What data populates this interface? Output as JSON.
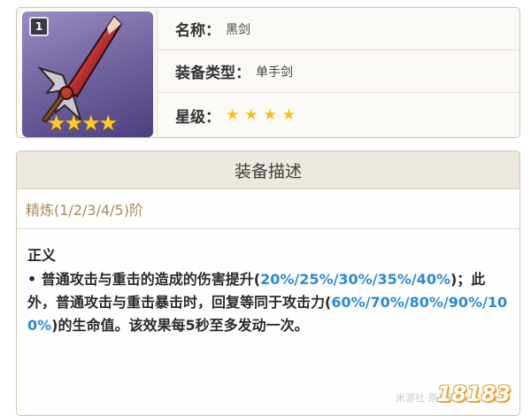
{
  "item": {
    "refinement_badge": "1",
    "name_label": "名称",
    "name_value": "黑剑",
    "type_label": "装备类型",
    "type_value": "单手剑",
    "rarity_label": "星级",
    "colon": "：",
    "rarity_stars": "★★★★",
    "rarity_count": 4,
    "star_color": "#f6bd16"
  },
  "description": {
    "title": "装备描述",
    "refinement_levels": "精炼(1/2/3/4/5)阶",
    "passive_name": "正义",
    "bullet": "•",
    "text_1": " 普通攻击与重击的造成的伤害提升(",
    "values_1": "20%/25%/30%/35%/40%",
    "text_2": ")；此外，普通攻击与重击暴击时，回复等同于攻击力(",
    "values_2": "60%/70%/80%/90%/100%",
    "text_3": ")的生命值。该效果每5秒至多发动一次。",
    "highlight_color": "#2d8ad6"
  },
  "watermark": {
    "site": "米游社·原神百科",
    "logo": "18183"
  }
}
